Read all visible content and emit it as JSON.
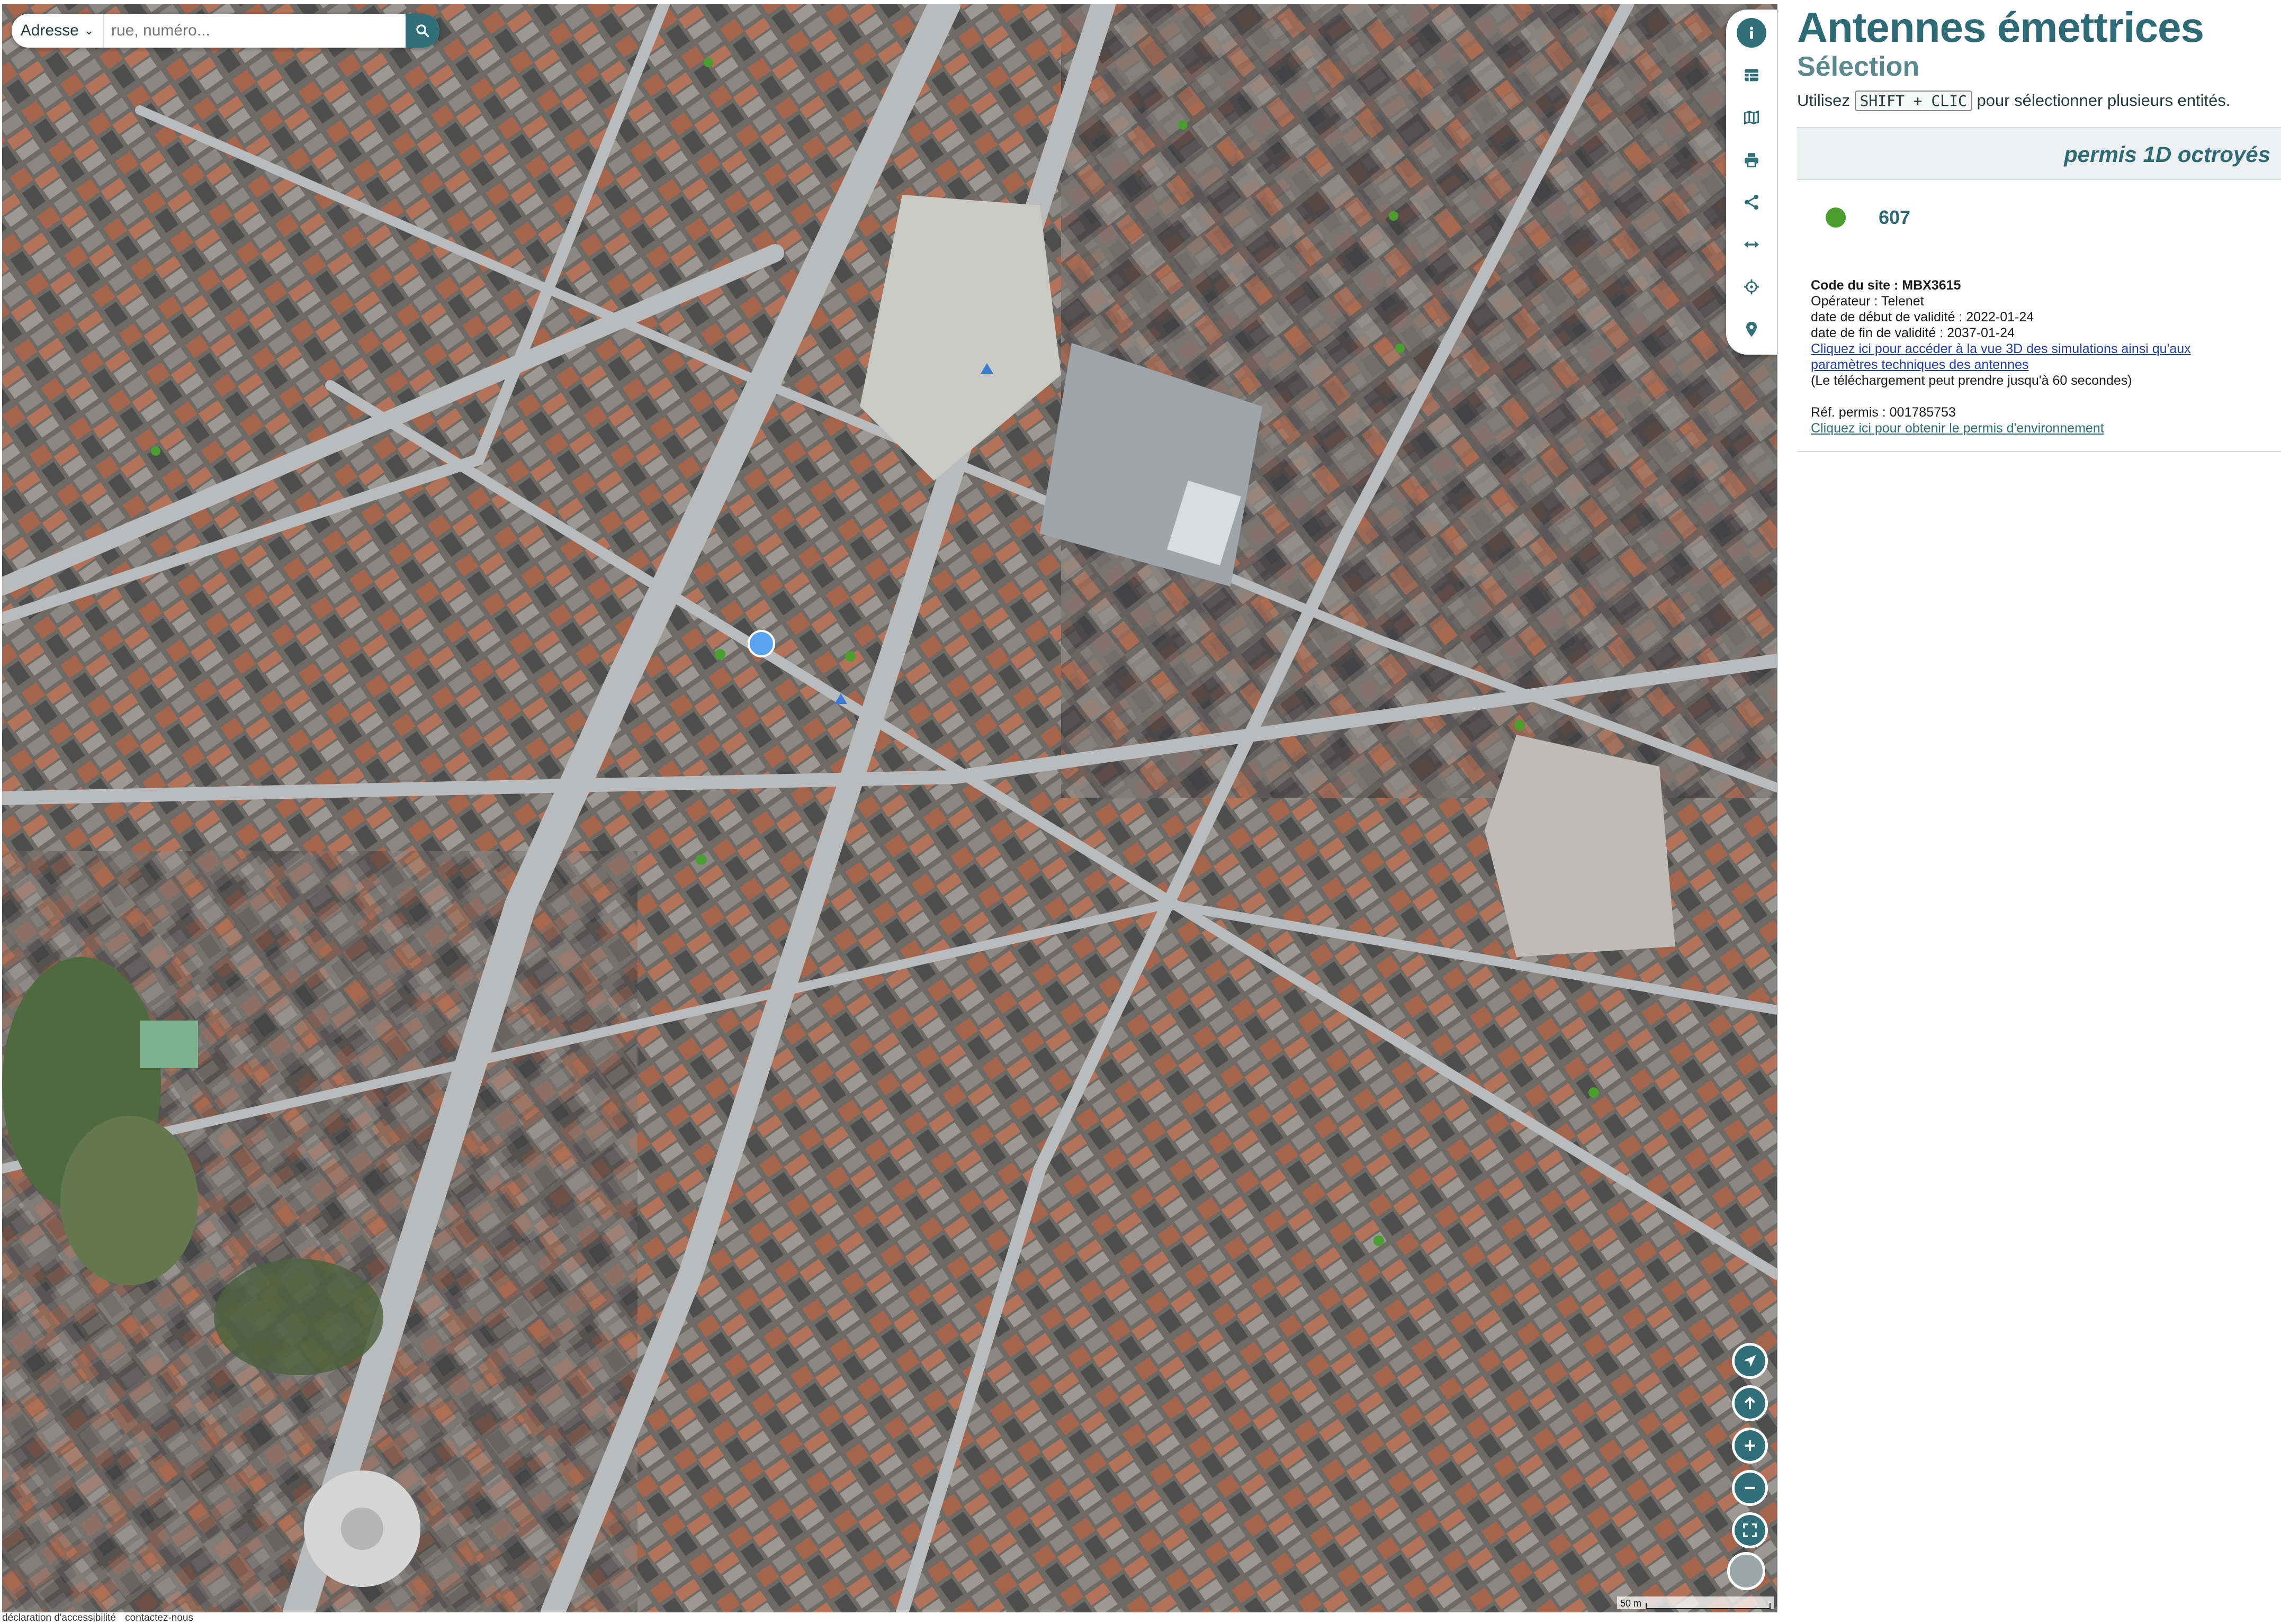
{
  "search": {
    "mode_label": "Adresse",
    "placeholder": "rue, numéro...",
    "value": ""
  },
  "toolbar": {
    "items": [
      {
        "icon": "info-icon",
        "active": true
      },
      {
        "icon": "table-icon"
      },
      {
        "icon": "map-icon"
      },
      {
        "icon": "print-icon"
      },
      {
        "icon": "share-icon"
      },
      {
        "icon": "measure-icon"
      },
      {
        "icon": "locate-icon"
      },
      {
        "icon": "marker-icon"
      }
    ]
  },
  "map_controls": [
    "navigate-icon",
    "north-arrow-icon",
    "zoom-in-icon",
    "zoom-out-icon",
    "fullscreen-icon"
  ],
  "scale": {
    "label": "50 m"
  },
  "footer": {
    "links": [
      "déclaration d'accessibilité",
      "contactez-nous"
    ]
  },
  "panel": {
    "title": "Antennes émettrices",
    "subtitle": "Sélection",
    "hint_before": "Utilisez",
    "hint_key": "SHIFT + CLIC",
    "hint_after": "pour sélectionner plusieurs entités.",
    "group_title": "permis 1D octroyés",
    "group_color": "#4a9e2e",
    "count": "607",
    "details": {
      "site_code_label": "Code du site :",
      "site_code": "MBX3615",
      "operator_line": "Opérateur : Telenet",
      "start_line": "date de début de validité : 2022-01-24",
      "end_line": "date de fin de validité : 2037-01-24",
      "link_3d": "Cliquez ici pour accéder à la vue 3D des simulations ainsi qu'aux paramètres techniques des antennes",
      "download_note": "(Le téléchargement peut prendre jusqu'à 60 secondes)",
      "permit_ref": "Réf. permis : 001785753",
      "permit_link": "Cliquez ici pour obtenir le permis d'environnement"
    }
  },
  "colors": {
    "accent": "#2f6f78",
    "title": "#2e6b76",
    "antenna_green": "#4a9e2e",
    "selected_marker": "#5aa3f0"
  }
}
